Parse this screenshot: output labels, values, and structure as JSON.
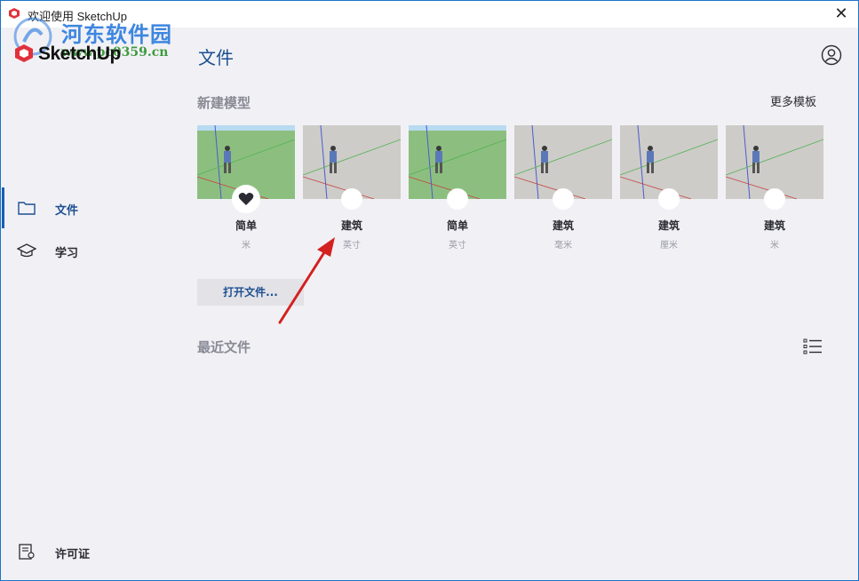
{
  "window": {
    "title": "欢迎使用 SketchUp",
    "close_glyph": "✕"
  },
  "watermark": {
    "title": "河东软件园",
    "url": "www.pc0359.cn"
  },
  "logo": {
    "text": "SketchUp"
  },
  "sidebar": {
    "items": [
      {
        "label": "文件",
        "icon": "folder-icon",
        "active": true
      },
      {
        "label": "学习",
        "icon": "graduation-cap-icon",
        "active": false
      },
      {
        "label": "许可证",
        "icon": "license-icon",
        "active": false
      }
    ]
  },
  "main": {
    "title": "文件",
    "new_model": {
      "heading": "新建模型",
      "more_templates": "更多模板",
      "templates": [
        {
          "name": "简单",
          "unit": "米",
          "style": "green",
          "default": true
        },
        {
          "name": "建筑",
          "unit": "英寸",
          "style": "gray",
          "default": false
        },
        {
          "name": "简单",
          "unit": "英寸",
          "style": "green",
          "default": false
        },
        {
          "name": "建筑",
          "unit": "毫米",
          "style": "gray",
          "default": false
        },
        {
          "name": "建筑",
          "unit": "厘米",
          "style": "gray",
          "default": false
        },
        {
          "name": "建筑",
          "unit": "米",
          "style": "gray",
          "default": false
        }
      ]
    },
    "open_file_label": "打开文件...",
    "recent": {
      "heading": "最近文件"
    }
  },
  "colors": {
    "accent": "#1d4f91",
    "background": "#f1f1f5",
    "arrow": "#d42020"
  }
}
